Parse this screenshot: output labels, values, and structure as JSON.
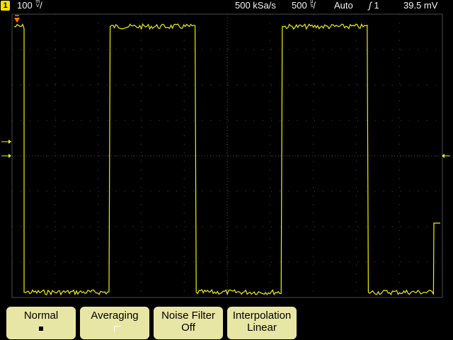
{
  "status": {
    "channel": "1",
    "volts_per_div": "100",
    "volts_unit_top": "m",
    "volts_unit_bottom": "V",
    "volts_slash": "/",
    "sample_rate": "500 kSa/s",
    "time_per_div": "500",
    "time_unit_top": "µ",
    "time_unit_bottom": "s",
    "time_slash": "/",
    "trigger_mode": "Auto",
    "trigger_source": "1",
    "trigger_level": "39.5 mV"
  },
  "colors": {
    "trace": "#f5f000",
    "grid": "#4a4a4a",
    "softkey_bg": "#e8e6a5",
    "trigger_marker": "#ff7a00"
  },
  "waveform": {
    "signal": "square",
    "high_level_divisions": 3.65,
    "low_level_divisions": -3.85,
    "period_divisions": 4.0,
    "duty_cycle": 0.5,
    "final_segment_level_divisions": -1.9
  },
  "softkeys": [
    {
      "label": "Normal",
      "value_icon": "selected-square-icon"
    },
    {
      "label": "Averaging",
      "value_icon": "unselected-corner-icon"
    },
    {
      "label": "Noise Filter",
      "value": "Off"
    },
    {
      "label": "Interpolation",
      "value": "Linear"
    }
  ]
}
